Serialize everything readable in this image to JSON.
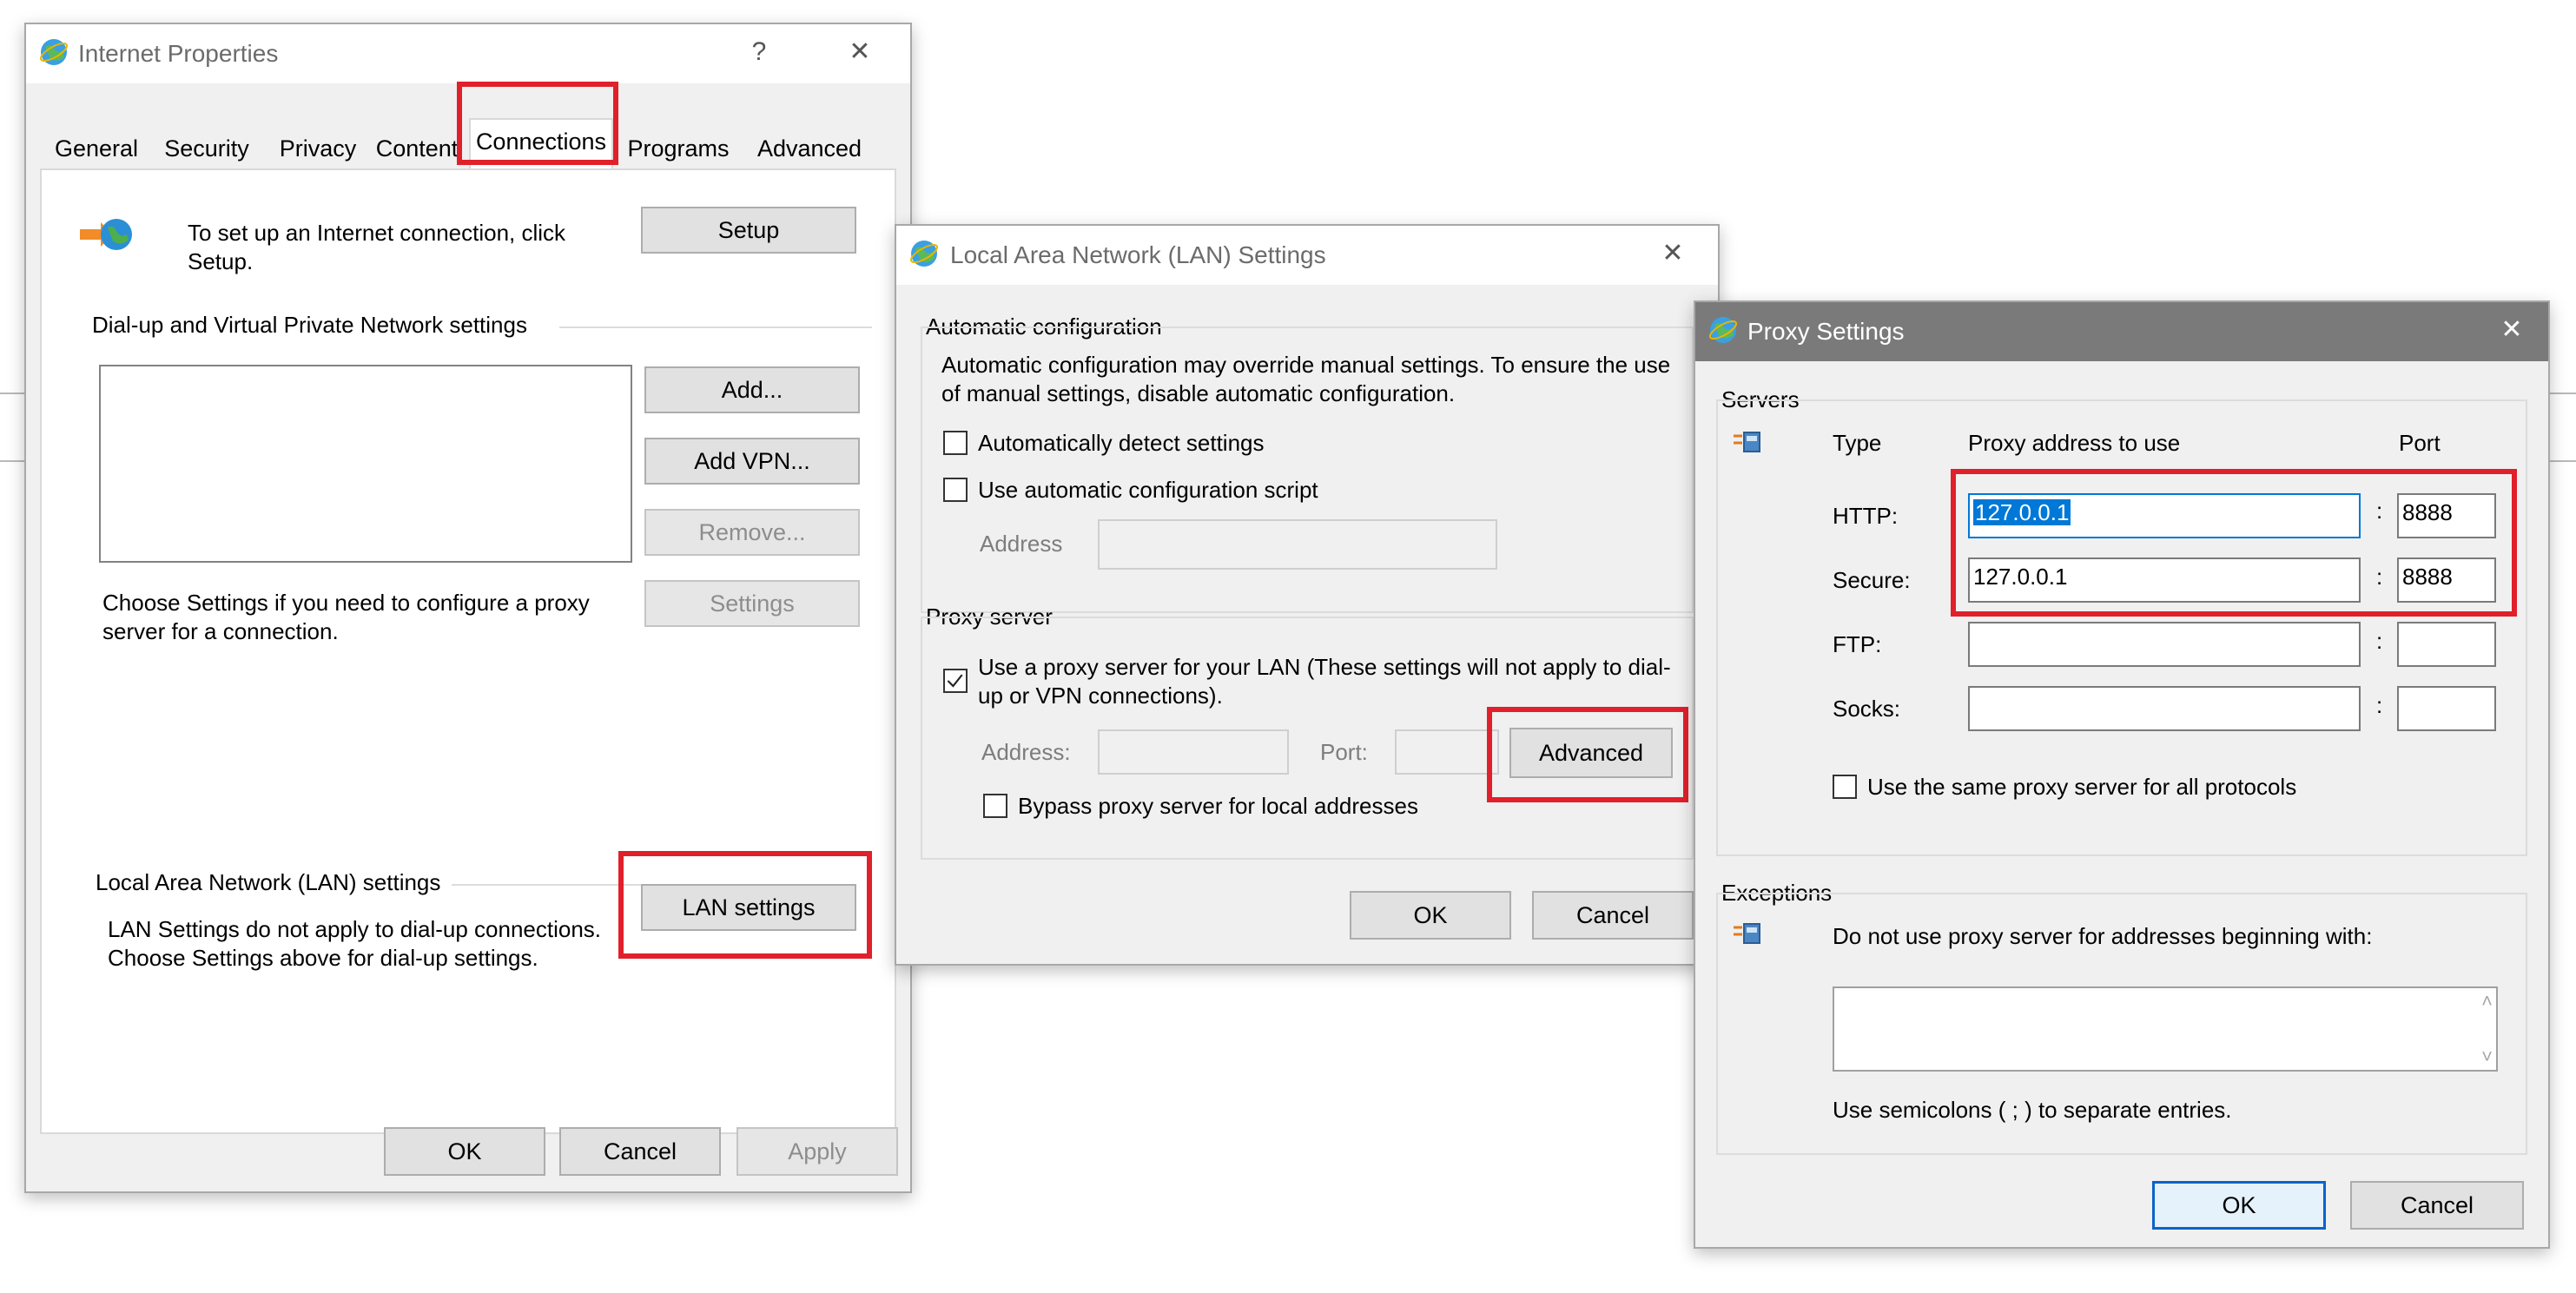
{
  "internet_properties": {
    "title": "Internet Properties",
    "help_glyph": "?",
    "close_glyph": "✕",
    "tabs": [
      "General",
      "Security",
      "Privacy",
      "Content",
      "Connections",
      "Programs",
      "Advanced"
    ],
    "active_tab": "Connections",
    "setup_text": "To set up an Internet connection, click Setup.",
    "setup_button": "Setup",
    "dialup_group": "Dial-up and Virtual Private Network settings",
    "add_button": "Add...",
    "add_vpn_button": "Add VPN...",
    "remove_button": "Remove...",
    "settings_button": "Settings",
    "proxy_hint": "Choose Settings if you need to configure a proxy server for a connection.",
    "lan_group": "Local Area Network (LAN) settings",
    "lan_hint": "LAN Settings do not apply to dial-up connections. Choose Settings above for dial-up settings.",
    "lan_button": "LAN settings",
    "ok": "OK",
    "cancel": "Cancel",
    "apply": "Apply"
  },
  "lan_settings": {
    "title": "Local Area Network (LAN) Settings",
    "close_glyph": "✕",
    "auto_group": "Automatic configuration",
    "auto_desc": "Automatic configuration may override manual settings.  To ensure the use of manual settings, disable automatic configuration.",
    "auto_detect": "Automatically detect settings",
    "auto_detect_checked": false,
    "auto_script": "Use automatic configuration script",
    "auto_script_checked": false,
    "address_label": "Address",
    "proxy_group": "Proxy server",
    "use_proxy": "Use a proxy server for your LAN (These settings will not apply to dial-up or VPN connections).",
    "use_proxy_checked": true,
    "proxy_address_label": "Address:",
    "proxy_port_label": "Port:",
    "advanced_button": "Advanced",
    "bypass": "Bypass proxy server for local addresses",
    "bypass_checked": false,
    "ok": "OK",
    "cancel": "Cancel"
  },
  "proxy_settings": {
    "title": "Proxy Settings",
    "close_glyph": "✕",
    "servers_group": "Servers",
    "col_type": "Type",
    "col_address": "Proxy address to use",
    "col_port": "Port",
    "colon": ":",
    "rows": [
      {
        "label": "HTTP:",
        "address": "127.0.0.1",
        "port": "8888"
      },
      {
        "label": "Secure:",
        "address": "127.0.0.1",
        "port": "8888"
      },
      {
        "label": "FTP:",
        "address": "",
        "port": ""
      },
      {
        "label": "Socks:",
        "address": "",
        "port": ""
      }
    ],
    "same_proxy": "Use the same proxy server for all protocols",
    "same_proxy_checked": false,
    "exceptions_group": "Exceptions",
    "exceptions_desc": "Do not use proxy server for addresses beginning with:",
    "exceptions_value": "",
    "exceptions_hint": "Use semicolons ( ; ) to separate entries.",
    "scroll_up_glyph": "˄",
    "scroll_down_glyph": "˅",
    "ok": "OK",
    "cancel": "Cancel"
  },
  "colors": {
    "highlight": "#e0202a",
    "selection": "#0078d7",
    "proxy_titlebar": "#7a7a7a"
  }
}
